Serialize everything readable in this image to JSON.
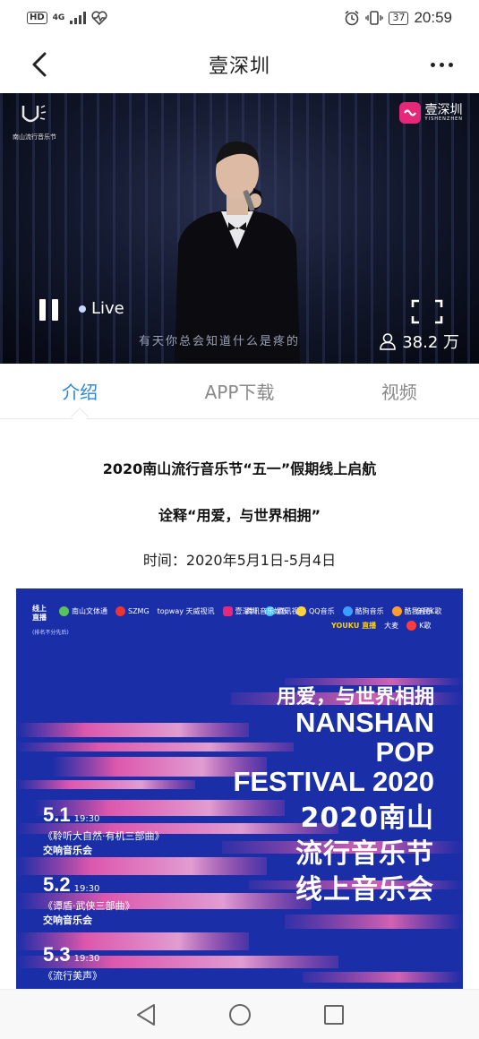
{
  "status_bar": {
    "left_badge": "HD",
    "signal": "4G",
    "battery": "37",
    "time": "20:59"
  },
  "header": {
    "title": "壹深圳"
  },
  "video": {
    "festival_logo_text": "南山流行音乐节",
    "brand_name": "壹深圳",
    "brand_sub": "YISHENZHEN",
    "live_label": "Live",
    "subtitle": "有天你总会知道什么是疼的",
    "viewer_count": "38.2 万",
    "is_playing": true
  },
  "tabs": [
    {
      "label": "介绍",
      "active": true
    },
    {
      "label": "APP下载",
      "active": false
    },
    {
      "label": "视频",
      "active": false
    }
  ],
  "article": {
    "title": "2020南山流行音乐节“五一”假期线上启航",
    "subtitle": "诠释“用爱，与世界相拥”",
    "time": "时间：2020年5月1日-5月4日"
  },
  "poster": {
    "online_label_1": "线上",
    "online_label_2": "直播",
    "rank_note": "(排名不分先后)",
    "sponsors_row1": [
      "南山文体通",
      "SZMG",
      "topway 天威视讯",
      "壹深圳",
      "腾讯视频",
      "腾讯音乐娱乐",
      "QQ音乐",
      "酷狗音乐",
      "酷我音乐",
      "全民K歌"
    ],
    "sponsors_row2": [
      "YOUKU 直播",
      "大麦",
      "K歌"
    ],
    "slogan": "用爱，与世界相拥",
    "en_line1": "NANSHAN",
    "en_line2": "POP",
    "en_line3": "FESTIVAL 2020",
    "cn_line1": "2020南山",
    "cn_line2": "流行音乐节",
    "cn_line3": "线上音乐会",
    "schedule": [
      {
        "date": "5.1",
        "time": "19:30",
        "work": "《聆听大自然·有机三部曲》",
        "kind": "交响音乐会"
      },
      {
        "date": "5.2",
        "time": "19:30",
        "work": "《谭盾·武侠三部曲》",
        "kind": "交响音乐会"
      },
      {
        "date": "5.3",
        "time": "19:30",
        "work": "《流行美声》",
        "kind": ""
      }
    ]
  }
}
